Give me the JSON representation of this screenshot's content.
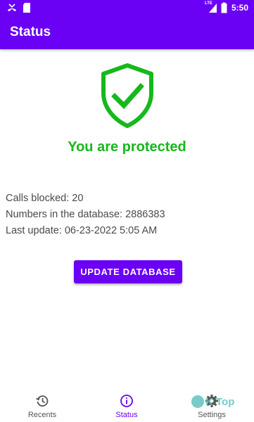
{
  "status_bar": {
    "time": "5:50",
    "network": "LTE",
    "icons": [
      "missed-call-icon",
      "sd-card-icon",
      "signal-icon",
      "battery-icon"
    ]
  },
  "app_bar": {
    "title": "Status"
  },
  "main": {
    "shield_icon": "shield-check-icon",
    "protection_status": "You are protected",
    "calls_blocked": "Calls blocked: 20",
    "numbers_in_db": "Numbers in the database: 2886383",
    "last_update": "Last update: 06-23-2022 5:05 AM",
    "update_button_label": "UPDATE DATABASE"
  },
  "bottom_nav": {
    "items": [
      {
        "label": "Recents",
        "icon": "history-icon",
        "active": false
      },
      {
        "label": "Status",
        "icon": "info-icon",
        "active": true
      },
      {
        "label": "Settings",
        "icon": "gear-icon",
        "active": false
      }
    ]
  },
  "watermark": {
    "text": "K Top"
  },
  "colors": {
    "primary": "#6a00f4",
    "protected_green": "#16b81c",
    "text_gray": "#4a4a4a"
  }
}
